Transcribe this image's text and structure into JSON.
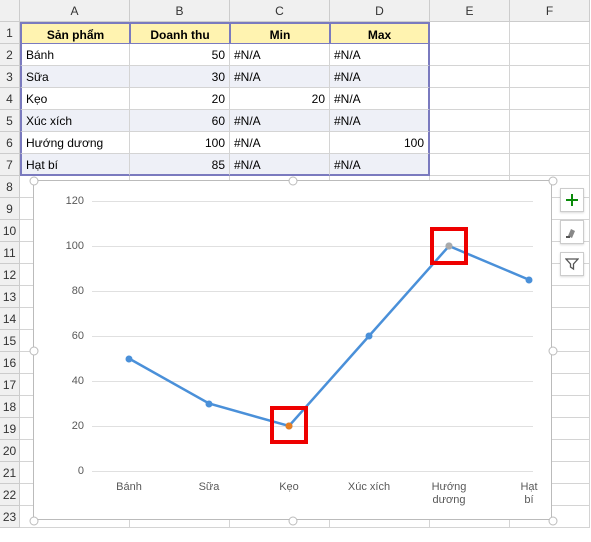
{
  "columns": [
    "A",
    "B",
    "C",
    "D",
    "E",
    "F"
  ],
  "rows": [
    "1",
    "2",
    "3",
    "4",
    "5",
    "6",
    "7",
    "8",
    "9",
    "10",
    "11",
    "12",
    "13",
    "14",
    "15",
    "16",
    "17",
    "18",
    "19",
    "20",
    "21",
    "22",
    "23"
  ],
  "table": {
    "headers": {
      "a": "Sản phẩm",
      "b": "Doanh thu",
      "c": "Min",
      "d": "Max"
    },
    "rows": [
      {
        "a": "Bánh",
        "b": "50",
        "c": "#N/A",
        "d": "#N/A"
      },
      {
        "a": "Sữa",
        "b": "30",
        "c": "#N/A",
        "d": "#N/A"
      },
      {
        "a": "Kẹo",
        "b": "20",
        "c": "20",
        "d": "#N/A"
      },
      {
        "a": "Xúc xích",
        "b": "60",
        "c": "#N/A",
        "d": "#N/A"
      },
      {
        "a": "Hướng dương",
        "b": "100",
        "c": "#N/A",
        "d": "100"
      },
      {
        "a": "Hạt bí",
        "b": "85",
        "c": "#N/A",
        "d": "#N/A"
      }
    ]
  },
  "chart_data": {
    "type": "line",
    "categories": [
      "Bánh",
      "Sữa",
      "Kẹo",
      "Xúc xích",
      "Hướng dương",
      "Hạt bí"
    ],
    "series": [
      {
        "name": "Doanh thu",
        "values": [
          50,
          30,
          20,
          60,
          100,
          85
        ]
      },
      {
        "name": "Min",
        "values": [
          null,
          null,
          20,
          null,
          null,
          null
        ]
      },
      {
        "name": "Max",
        "values": [
          null,
          null,
          null,
          null,
          100,
          null
        ]
      }
    ],
    "ylim": [
      0,
      120
    ],
    "yticks": [
      0,
      20,
      40,
      60,
      80,
      100,
      120
    ],
    "highlight_boxes": [
      {
        "around_index": 2,
        "color": "#e00"
      },
      {
        "around_index": 4,
        "color": "#e00"
      }
    ]
  },
  "yticks": {
    "t0": "0",
    "t1": "20",
    "t2": "40",
    "t3": "60",
    "t4": "80",
    "t5": "100",
    "t6": "120"
  },
  "xticks": {
    "x0": "Bánh",
    "x1": "Sữa",
    "x2": "Kẹo",
    "x3": "Xúc xích",
    "x4": "Hướng\ndương",
    "x5": "Hạt bí"
  }
}
